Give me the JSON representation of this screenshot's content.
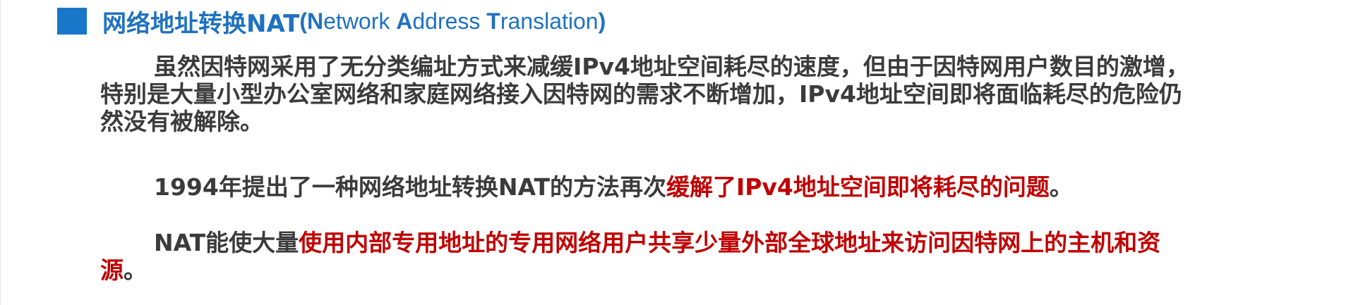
{
  "heading": {
    "title": "网络地址转换NAT",
    "open_paren": "(",
    "n_cap": "N",
    "n_rest": "etwork ",
    "a_cap": "A",
    "a_rest": "ddress ",
    "t_cap": "T",
    "t_rest": "ranslation",
    "close_paren": ")"
  },
  "paragraphs": {
    "p1": {
      "text": "虽然因特网采用了无分类编址方式来减缓IPv4地址空间耗尽的速度，但由于因特网用户数目的激增，特别是大量小型办公室网络和家庭网络接入因特网的需求不断增加，IPv4地址空间即将面临耗尽的危险仍然没有被解除。"
    },
    "p2": {
      "normal": "1994年提出了一种网络地址转换NAT的方法再次",
      "highlight": "缓解了IPv4地址空间即将耗尽的问题",
      "end": "。"
    },
    "p3": {
      "normal": "NAT能使大量",
      "highlight": "使用内部专用地址的专用网络用户共享少量外部全球地址来访问因特网上的主机和资源",
      "end": "。"
    }
  },
  "colors": {
    "heading_blue": "#1f72bf",
    "square_blue": "#1976c8",
    "body_gray": "#3b3b3b",
    "highlight_red": "#c00000"
  }
}
